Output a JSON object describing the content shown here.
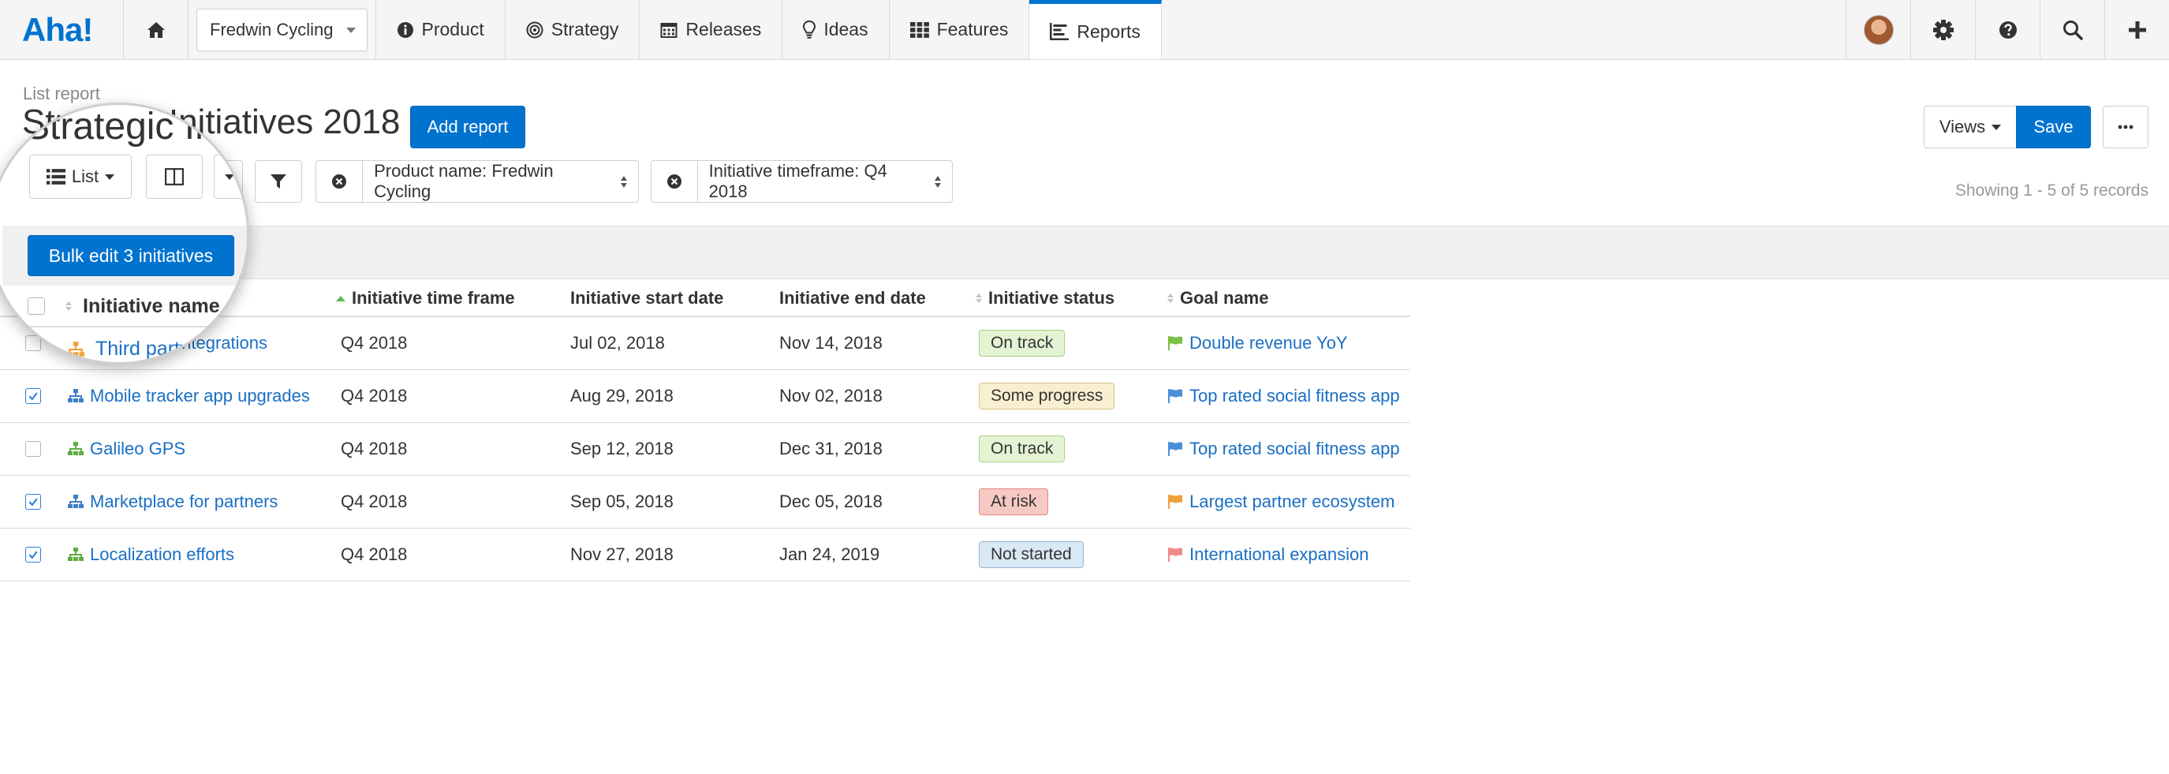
{
  "nav": {
    "logo": "Aha!",
    "product_select": "Fredwin Cycling",
    "items": [
      {
        "label": "Product",
        "icon": "info-circle-icon"
      },
      {
        "label": "Strategy",
        "icon": "target-icon"
      },
      {
        "label": "Releases",
        "icon": "calendar-icon"
      },
      {
        "label": "Ideas",
        "icon": "lightbulb-icon"
      },
      {
        "label": "Features",
        "icon": "grid-icon"
      },
      {
        "label": "Reports",
        "icon": "report-icon"
      }
    ],
    "active": "Reports",
    "accent_color": "#0073cf"
  },
  "header": {
    "report_type": "List report",
    "title": "Strategic Initiatives 2018",
    "add_report": "Add report",
    "views": "Views",
    "save": "Save",
    "more": "···"
  },
  "toolbar": {
    "list_label": "List",
    "filters": [
      {
        "label": "Product name: Fredwin Cycling"
      },
      {
        "label": "Initiative timeframe: Q4 2018"
      }
    ],
    "showing": "Showing 1 - 5 of 5 records"
  },
  "bulk_edit": "Bulk edit 3 initiatives",
  "table": {
    "columns": [
      "Initiative name",
      "Initiative time frame",
      "Initiative start date",
      "Initiative end date",
      "Initiative status",
      "Goal name"
    ],
    "rows": [
      {
        "checked": false,
        "name": "Third party integrations",
        "timeframe": "Q4 2018",
        "start": "Jul 02, 2018",
        "end": "Nov 14, 2018",
        "status": "On track",
        "status_kind": "ontrack",
        "goal": "Double revenue YoY",
        "goal_color": "#7cc143",
        "icon_color": "#f0a13c"
      },
      {
        "checked": true,
        "name": "Mobile tracker app upgrades",
        "timeframe": "Q4 2018",
        "start": "Aug 29, 2018",
        "end": "Nov 02, 2018",
        "status": "Some progress",
        "status_kind": "some",
        "goal": "Top rated social fitness app",
        "goal_color": "#4a90d9",
        "icon_color": "#3d7fc6"
      },
      {
        "checked": false,
        "name": "Galileo GPS",
        "timeframe": "Q4 2018",
        "start": "Sep 12, 2018",
        "end": "Dec 31, 2018",
        "status": "On track",
        "status_kind": "ontrack",
        "goal": "Top rated social fitness app",
        "goal_color": "#4a90d9",
        "icon_color": "#5cae3c"
      },
      {
        "checked": true,
        "name": "Marketplace for partners",
        "timeframe": "Q4 2018",
        "start": "Sep 05, 2018",
        "end": "Dec 05, 2018",
        "status": "At risk",
        "status_kind": "risk",
        "goal": "Largest partner ecosystem",
        "goal_color": "#f0a13c",
        "icon_color": "#3d7fc6"
      },
      {
        "checked": true,
        "name": "Localization efforts",
        "timeframe": "Q4 2018",
        "start": "Nov 27, 2018",
        "end": "Jan 24, 2019",
        "status": "Not started",
        "status_kind": "not",
        "goal": "International expansion",
        "goal_color": "#ee8a85",
        "icon_color": "#5cae3c"
      }
    ]
  }
}
